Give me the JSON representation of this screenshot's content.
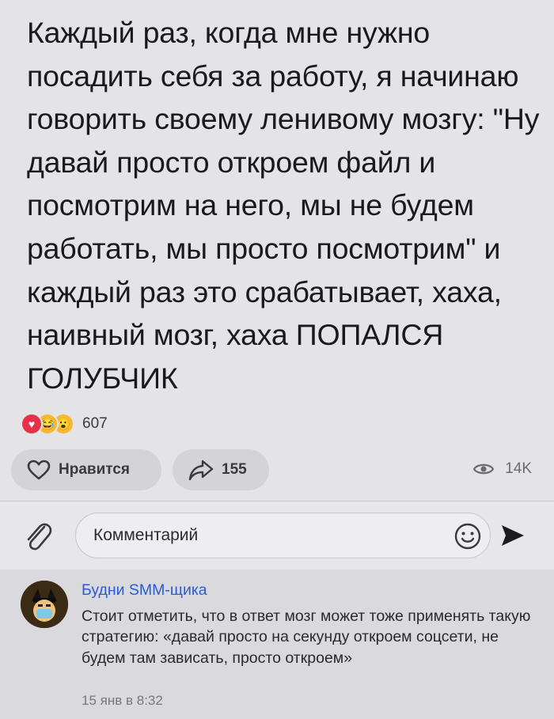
{
  "post": {
    "text": "Каждый раз, когда мне нужно посадить себя за работу, я начинаю говорить своему ленивому мозгу: \"Ну давай просто откроем файл и посмотрим на него, мы не будем работать, мы просто посмотрим\" и каждый раз это срабатывает, хаха, наивный мозг, хаха ПОПАЛСЯ ГОЛУБЧИК",
    "reactions": {
      "icons": [
        "heart-icon",
        "laugh-emoji-icon",
        "wow-emoji-icon"
      ],
      "count": "607"
    },
    "like_label": "Нравится",
    "share_count": "155",
    "views": "14K"
  },
  "comment_box": {
    "placeholder": "Комментарий"
  },
  "comments": [
    {
      "author": "Будни SMM-щика",
      "text": "Стоит отметить, что в ответ мозг может тоже применять такую стратегию: «давай просто на секунду откроем соцсети, не будем там зависать, просто откроем»",
      "time": "15 янв в 8:32"
    }
  ],
  "colors": {
    "post_bg": "#e4e4e6",
    "pill_bg": "#d4d4d8",
    "author_link": "#2a5bd8",
    "comment_bg": "#d9d9de",
    "heart": "#e6314a"
  }
}
